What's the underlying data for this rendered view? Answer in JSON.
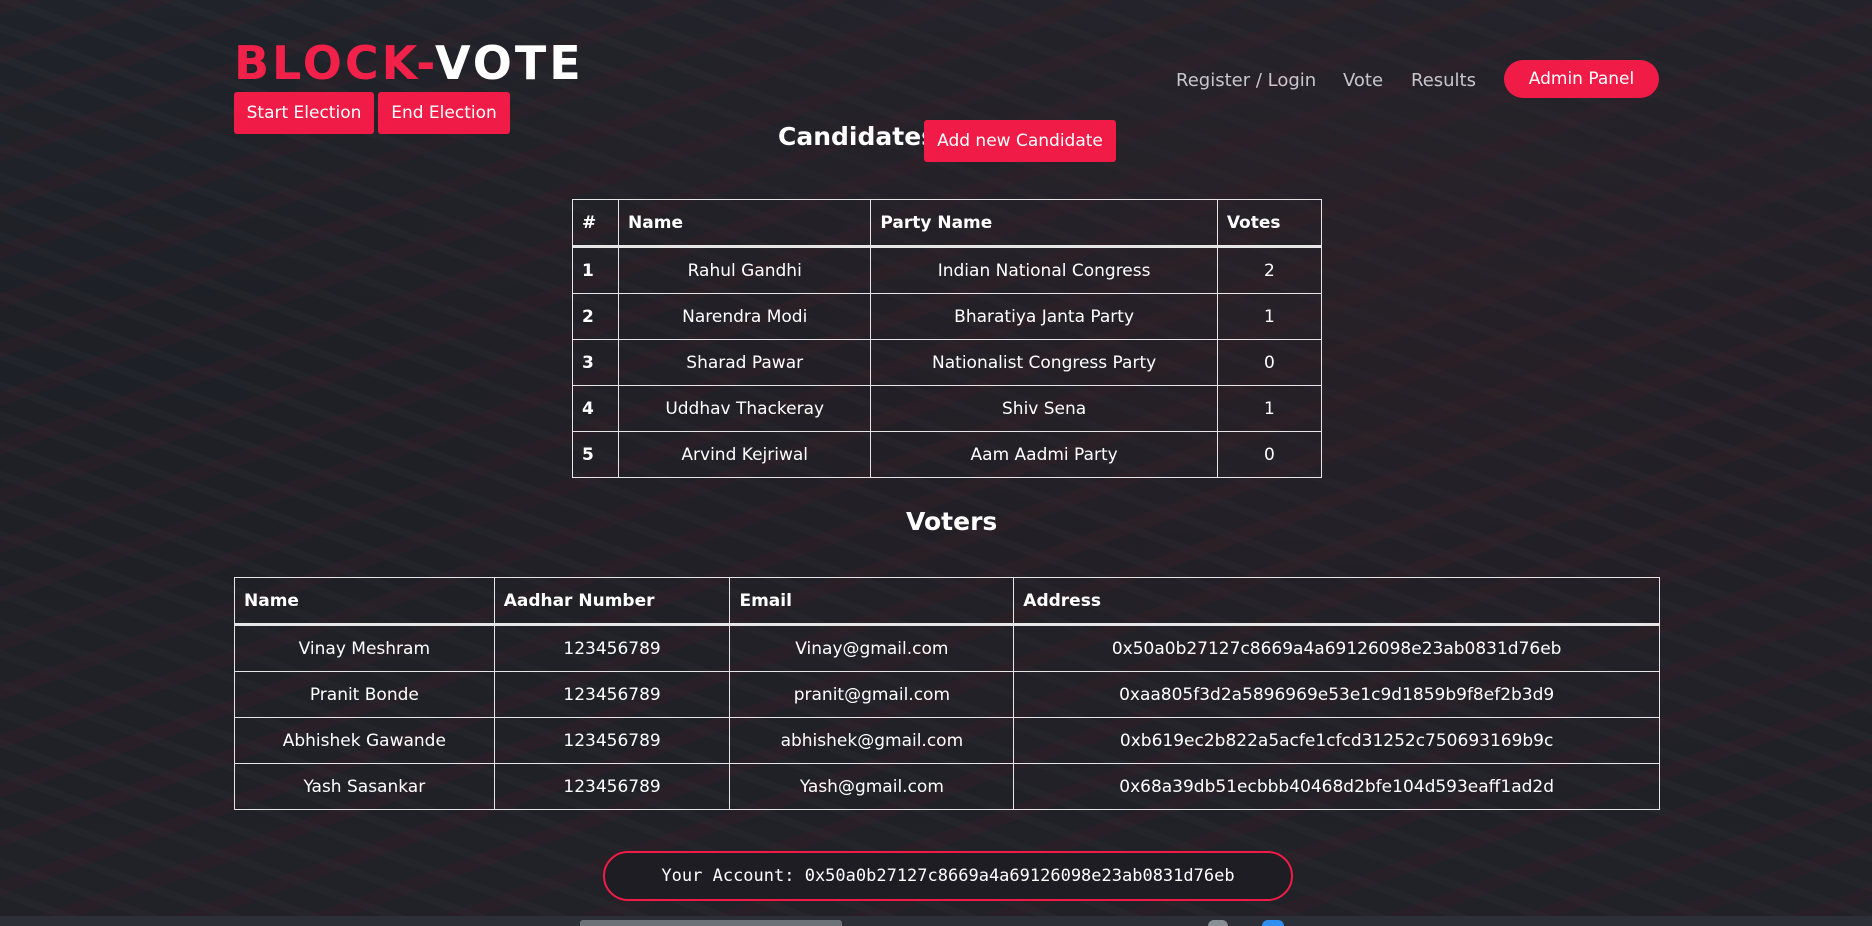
{
  "brand": {
    "part1": "BLOCK-",
    "part2": "VOTE",
    "accent": "#f01c47"
  },
  "admin_actions": {
    "start": "Start Election",
    "end": "End Election"
  },
  "nav": {
    "register": "Register / Login",
    "vote": "Vote",
    "results": "Results",
    "admin": "Admin Panel"
  },
  "candidates": {
    "title": "Candidates",
    "add_label": "Add new Candidate",
    "headers": [
      "#",
      "Name",
      "Party Name",
      "Votes"
    ],
    "rows": [
      {
        "id": "1",
        "name": "Rahul Gandhi",
        "party": "Indian National Congress",
        "votes": "2"
      },
      {
        "id": "2",
        "name": "Narendra Modi",
        "party": "Bharatiya Janta Party",
        "votes": "1"
      },
      {
        "id": "3",
        "name": "Sharad Pawar",
        "party": "Nationalist Congress Party",
        "votes": "0"
      },
      {
        "id": "4",
        "name": "Uddhav Thackeray",
        "party": "Shiv Sena",
        "votes": "1"
      },
      {
        "id": "5",
        "name": "Arvind Kejriwal",
        "party": "Aam Aadmi Party",
        "votes": "0"
      }
    ]
  },
  "voters": {
    "title": "Voters",
    "headers": [
      "Name",
      "Aadhar Number",
      "Email",
      "Address"
    ],
    "rows": [
      {
        "name": "Vinay Meshram",
        "aadhar": "123456789",
        "email": "Vinay@gmail.com",
        "address": "0x50a0b27127c8669a4a69126098e23ab0831d76eb"
      },
      {
        "name": "Pranit Bonde",
        "aadhar": "123456789",
        "email": "pranit@gmail.com",
        "address": "0xaa805f3d2a5896969e53e1c9d1859b9f8ef2b3d9"
      },
      {
        "name": "Abhishek Gawande",
        "aadhar": "123456789",
        "email": "abhishek@gmail.com",
        "address": "0xb619ec2b822a5acfe1cfcd31252c750693169b9c"
      },
      {
        "name": "Yash Sasankar",
        "aadhar": "123456789",
        "email": "Yash@gmail.com",
        "address": "0x68a39db51ecbbb40468d2bfe104d593eaff1ad2d"
      }
    ]
  },
  "account": {
    "text": "Your Account: 0x50a0b27127c8669a4a69126098e23ab0831d76eb"
  }
}
